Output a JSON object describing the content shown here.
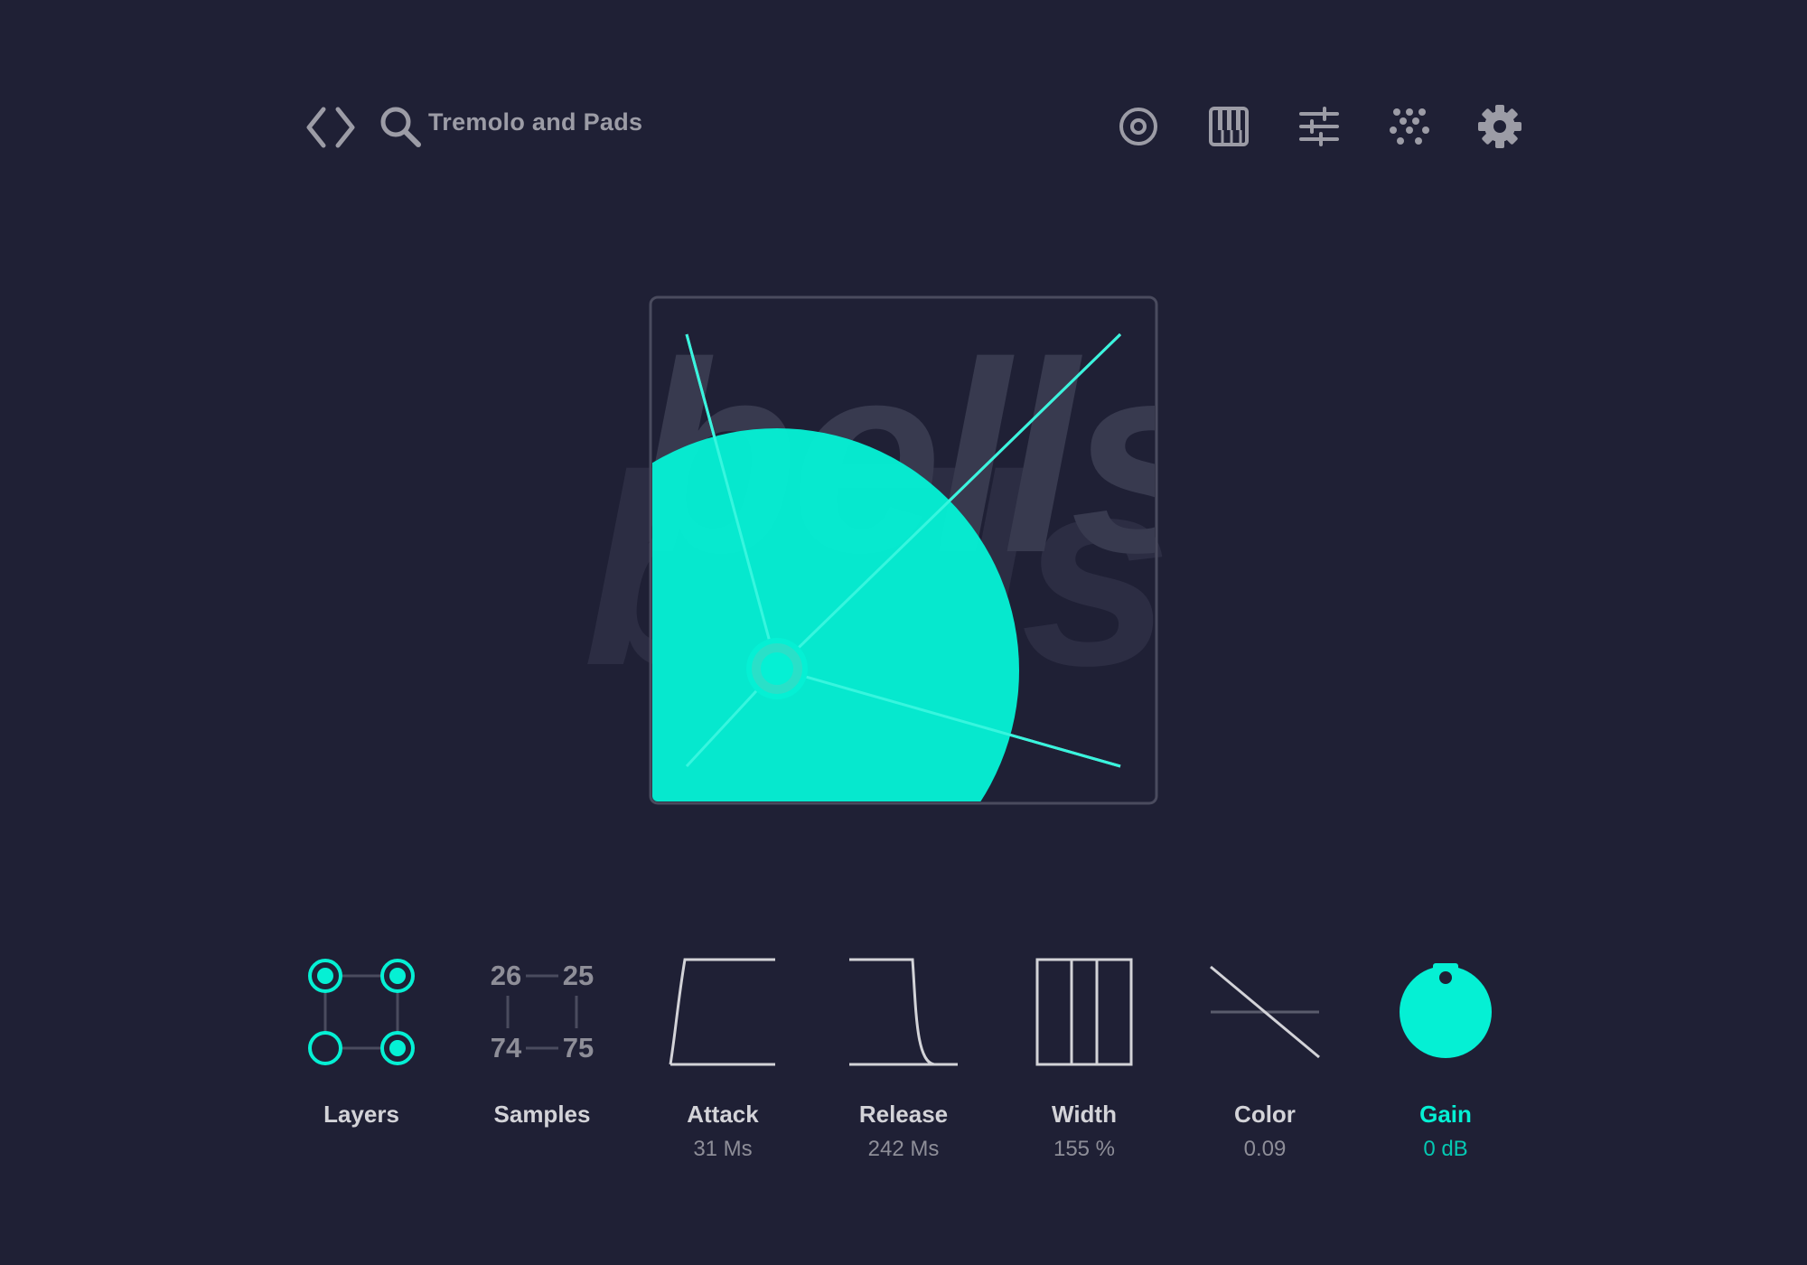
{
  "header": {
    "preset_name": "Tremolo and Pads",
    "left_icons": [
      "code-brackets-icon",
      "search-icon"
    ],
    "right_icons": [
      "target-icon",
      "piano-keys-icon",
      "sliders-icon",
      "dots-grid-icon",
      "gear-icon"
    ]
  },
  "visualizer": {
    "watermark_text": "bells",
    "colors": {
      "accent": "#05f0d4",
      "background": "#1f2035",
      "frame": "#4a4b5e",
      "watermark": "#383a4f"
    }
  },
  "controls": {
    "layers": {
      "label": "Layers"
    },
    "samples": {
      "label": "Samples",
      "numbers": [
        "26",
        "25",
        "74",
        "75"
      ]
    },
    "attack": {
      "label": "Attack",
      "value": "31 Ms"
    },
    "release": {
      "label": "Release",
      "value": "242 Ms"
    },
    "width": {
      "label": "Width",
      "value": "155 %"
    },
    "color": {
      "label": "Color",
      "value": "0.09"
    },
    "gain": {
      "label": "Gain",
      "value": "0 dB"
    }
  }
}
